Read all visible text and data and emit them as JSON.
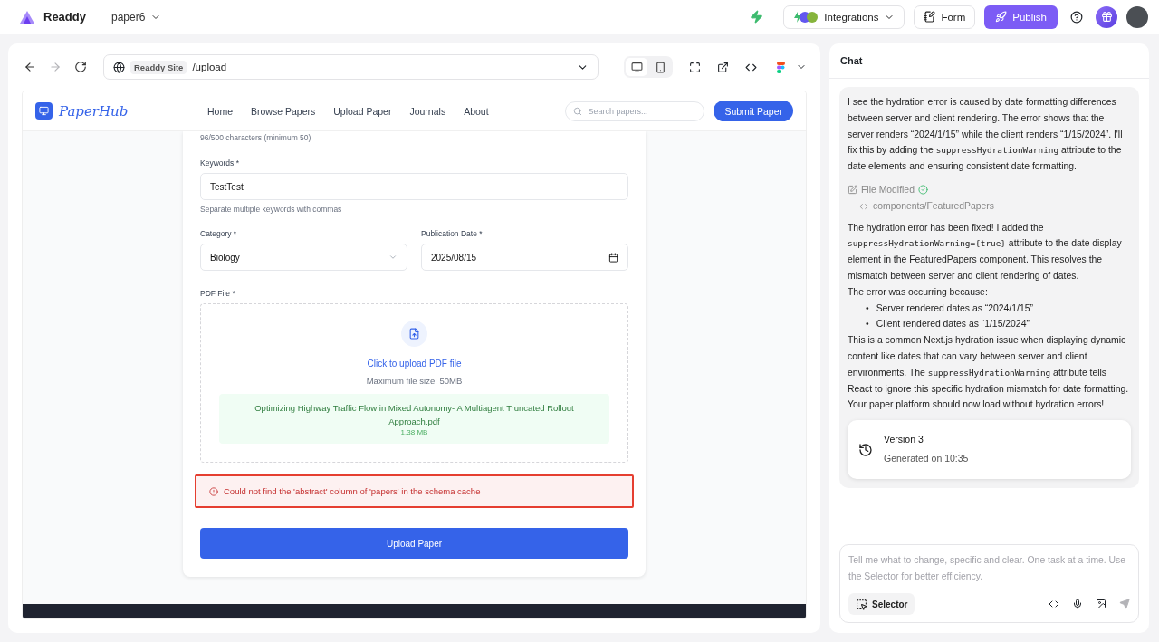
{
  "topbar": {
    "brand": "Readdy",
    "project": "paper6",
    "integrations": "Integrations",
    "form": "Form",
    "publish": "Publish"
  },
  "browser": {
    "nav": [
      {
        "kind": "back",
        "disabled": false
      },
      {
        "kind": "forward",
        "disabled": true
      },
      {
        "kind": "reload",
        "disabled": false
      }
    ],
    "site_badge": "Readdy Site",
    "path": "/upload",
    "devices": [
      {
        "kind": "desktop",
        "selected": true
      },
      {
        "kind": "mobile",
        "selected": false
      }
    ]
  },
  "site": {
    "logo": "PaperHub",
    "nav": [
      "Home",
      "Browse Papers",
      "Upload Paper",
      "Journals",
      "About"
    ],
    "search": {
      "placeholder": "Search papers..."
    },
    "submit": "Submit Paper"
  },
  "form": {
    "char_count": "96/500 characters (minimum 50)",
    "keywords": {
      "label": "Keywords *",
      "value": "TestTest",
      "hint": "Separate multiple keywords with commas"
    },
    "category": {
      "label": "Category *",
      "value": "Biology"
    },
    "date": {
      "label": "Publication Date *",
      "value": "2025/08/15"
    },
    "pdf": {
      "label": "PDF File *",
      "upload_link": "Click to upload PDF file",
      "max_size": "Maximum file size: 50MB",
      "file_name": "Optimizing Highway Traffic Flow in Mixed Autonomy- A Multiagent Truncated Rollout Approach.pdf",
      "file_size": "1.38 MB"
    },
    "error": "Could not find the 'abstract' column of 'papers' in the schema cache",
    "upload_button": "Upload Paper"
  },
  "chat": {
    "title": "Chat",
    "intro": [
      {
        "kind": "text",
        "text": "I see the hydration error is caused by date formatting differences between server and client rendering. The error shows that the server renders “2024/1/15” while the client renders “1/15/2024”. I'll fix this by adding the "
      },
      {
        "kind": "code",
        "text": "suppressHydrationWarning"
      },
      {
        "kind": "text",
        "text": " attribute to the date elements and ensuring consistent date formatting."
      }
    ],
    "file_status": "File Modified",
    "file_path": "components/FeaturedPapers",
    "fixed": [
      {
        "kind": "text",
        "text": "The hydration error has been fixed! I added the "
      },
      {
        "kind": "code",
        "text": "suppressHydrationWarning={true}"
      },
      {
        "kind": "text",
        "text": " attribute to the date display element in the FeaturedPapers component. This resolves the mismatch between server and client rendering of dates."
      }
    ],
    "cause": "The error was occurring because:",
    "bullets": [
      {
        "marker": "•",
        "text": "Server rendered dates as “2024/1/15”"
      },
      {
        "marker": "•",
        "text": "Client rendered dates as “1/15/2024”"
      }
    ],
    "explain": [
      {
        "kind": "text",
        "text": "This is a common Next.js hydration issue when displaying dynamic content like dates that can vary between server and client environments. The "
      },
      {
        "kind": "code",
        "text": "suppressHydrationWarning"
      },
      {
        "kind": "text",
        "text": " attribute tells React to ignore this specific hydration mismatch for date formatting."
      }
    ],
    "closing": "Your paper platform should now load without hydration errors!",
    "version": {
      "title": "Version 3",
      "time": "Generated on 10:35"
    },
    "input": {
      "placeholder": "Tell me what to change, specific and clear. One task at a time. Use the Selector for better efficiency."
    },
    "selector": "Selector"
  }
}
